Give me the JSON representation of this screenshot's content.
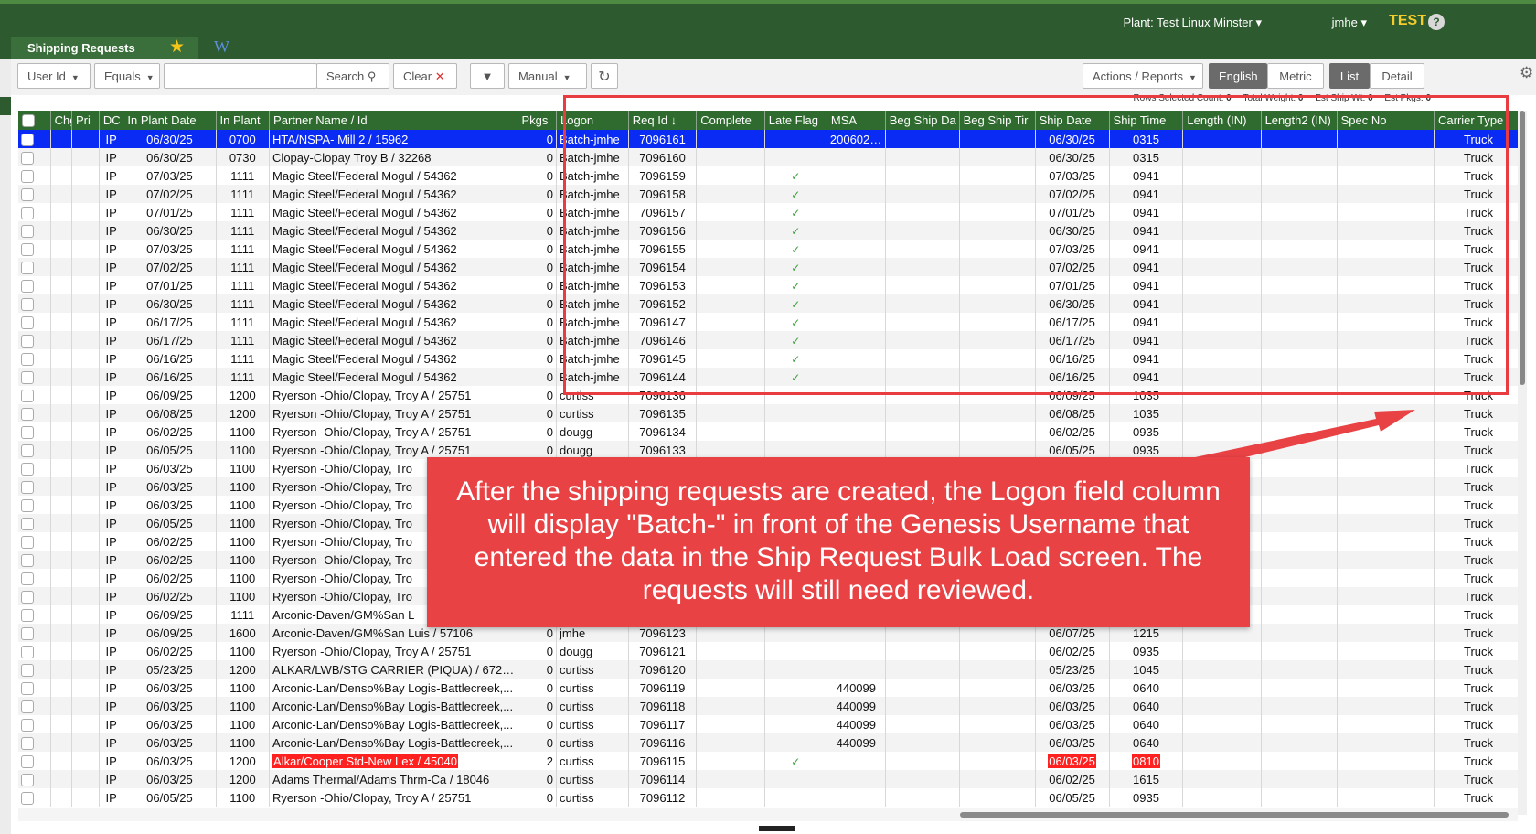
{
  "topbar": {
    "plant": "Plant: Test Linux Minster",
    "user": "jmhe",
    "env": "TEST",
    "help": "?"
  },
  "tab": {
    "label": "Shipping Requests",
    "star": "★",
    "wiki": "W"
  },
  "toolbar": {
    "field": "User Id",
    "operator": "Equals",
    "search_value": "",
    "search_label": "Search",
    "clear_label": "Clear",
    "mode": "Manual",
    "actions": "Actions / Reports",
    "unit_english": "English",
    "unit_metric": "Metric",
    "view_list": "List",
    "view_detail": "Detail"
  },
  "stats": {
    "rows_selected": "Rows Selected Count:",
    "rows_selected_val": "0",
    "total_weight": "Total Weight:",
    "total_weight_val": "0",
    "est_ship": "Est Ship Wt:",
    "est_ship_val": "0",
    "est_pkgs": "Est Pkgs:",
    "est_pkgs_val": "0"
  },
  "columns": [
    "",
    "Chg",
    "Pri",
    "DC",
    "In Plant Date",
    "In Plant",
    "Partner Name / Id",
    "Pkgs",
    "Logon",
    "Req Id ↓",
    "Complete",
    "Late Flag",
    "MSA",
    "Beg Ship Da",
    "Beg Ship Tir",
    "Ship Date",
    "Ship Time",
    "Length (IN)",
    "Length2 (IN)",
    "Spec No",
    "Carrier Type"
  ],
  "rows": [
    {
      "dc": "IP",
      "ipd": "06/30/25",
      "ipt": "0700",
      "partner": "HTA/NSPA- Mill 2 / 15962",
      "pkgs": "0",
      "logon": "Batch-jmhe",
      "req": "7096161",
      "late": "",
      "msa": "2006028...",
      "sdate": "06/30/25",
      "stime": "0315",
      "carrier": "Truck",
      "sel": true
    },
    {
      "dc": "IP",
      "ipd": "06/30/25",
      "ipt": "0730",
      "partner": "Clopay-Clopay Troy B / 32268",
      "pkgs": "0",
      "logon": "Batch-jmhe",
      "req": "7096160",
      "late": "",
      "msa": "",
      "sdate": "06/30/25",
      "stime": "0315",
      "carrier": "Truck"
    },
    {
      "dc": "IP",
      "ipd": "07/03/25",
      "ipt": "1111",
      "partner": "Magic Steel/Federal Mogul / 54362",
      "pkgs": "0",
      "logon": "Batch-jmhe",
      "req": "7096159",
      "late": "✓",
      "msa": "",
      "sdate": "07/03/25",
      "stime": "0941",
      "carrier": "Truck"
    },
    {
      "dc": "IP",
      "ipd": "07/02/25",
      "ipt": "1111",
      "partner": "Magic Steel/Federal Mogul / 54362",
      "pkgs": "0",
      "logon": "Batch-jmhe",
      "req": "7096158",
      "late": "✓",
      "msa": "",
      "sdate": "07/02/25",
      "stime": "0941",
      "carrier": "Truck"
    },
    {
      "dc": "IP",
      "ipd": "07/01/25",
      "ipt": "1111",
      "partner": "Magic Steel/Federal Mogul / 54362",
      "pkgs": "0",
      "logon": "Batch-jmhe",
      "req": "7096157",
      "late": "✓",
      "msa": "",
      "sdate": "07/01/25",
      "stime": "0941",
      "carrier": "Truck"
    },
    {
      "dc": "IP",
      "ipd": "06/30/25",
      "ipt": "1111",
      "partner": "Magic Steel/Federal Mogul / 54362",
      "pkgs": "0",
      "logon": "Batch-jmhe",
      "req": "7096156",
      "late": "✓",
      "msa": "",
      "sdate": "06/30/25",
      "stime": "0941",
      "carrier": "Truck"
    },
    {
      "dc": "IP",
      "ipd": "07/03/25",
      "ipt": "1111",
      "partner": "Magic Steel/Federal Mogul / 54362",
      "pkgs": "0",
      "logon": "Batch-jmhe",
      "req": "7096155",
      "late": "✓",
      "msa": "",
      "sdate": "07/03/25",
      "stime": "0941",
      "carrier": "Truck"
    },
    {
      "dc": "IP",
      "ipd": "07/02/25",
      "ipt": "1111",
      "partner": "Magic Steel/Federal Mogul / 54362",
      "pkgs": "0",
      "logon": "Batch-jmhe",
      "req": "7096154",
      "late": "✓",
      "msa": "",
      "sdate": "07/02/25",
      "stime": "0941",
      "carrier": "Truck"
    },
    {
      "dc": "IP",
      "ipd": "07/01/25",
      "ipt": "1111",
      "partner": "Magic Steel/Federal Mogul / 54362",
      "pkgs": "0",
      "logon": "Batch-jmhe",
      "req": "7096153",
      "late": "✓",
      "msa": "",
      "sdate": "07/01/25",
      "stime": "0941",
      "carrier": "Truck"
    },
    {
      "dc": "IP",
      "ipd": "06/30/25",
      "ipt": "1111",
      "partner": "Magic Steel/Federal Mogul / 54362",
      "pkgs": "0",
      "logon": "Batch-jmhe",
      "req": "7096152",
      "late": "✓",
      "msa": "",
      "sdate": "06/30/25",
      "stime": "0941",
      "carrier": "Truck"
    },
    {
      "dc": "IP",
      "ipd": "06/17/25",
      "ipt": "1111",
      "partner": "Magic Steel/Federal Mogul / 54362",
      "pkgs": "0",
      "logon": "Batch-jmhe",
      "req": "7096147",
      "late": "✓",
      "msa": "",
      "sdate": "06/17/25",
      "stime": "0941",
      "carrier": "Truck"
    },
    {
      "dc": "IP",
      "ipd": "06/17/25",
      "ipt": "1111",
      "partner": "Magic Steel/Federal Mogul / 54362",
      "pkgs": "0",
      "logon": "Batch-jmhe",
      "req": "7096146",
      "late": "✓",
      "msa": "",
      "sdate": "06/17/25",
      "stime": "0941",
      "carrier": "Truck"
    },
    {
      "dc": "IP",
      "ipd": "06/16/25",
      "ipt": "1111",
      "partner": "Magic Steel/Federal Mogul / 54362",
      "pkgs": "0",
      "logon": "Batch-jmhe",
      "req": "7096145",
      "late": "✓",
      "msa": "",
      "sdate": "06/16/25",
      "stime": "0941",
      "carrier": "Truck"
    },
    {
      "dc": "IP",
      "ipd": "06/16/25",
      "ipt": "1111",
      "partner": "Magic Steel/Federal Mogul / 54362",
      "pkgs": "0",
      "logon": "Batch-jmhe",
      "req": "7096144",
      "late": "✓",
      "msa": "",
      "sdate": "06/16/25",
      "stime": "0941",
      "carrier": "Truck"
    },
    {
      "dc": "IP",
      "ipd": "06/09/25",
      "ipt": "1200",
      "partner": "Ryerson -Ohio/Clopay, Troy A / 25751",
      "pkgs": "0",
      "logon": "curtiss",
      "req": "7096136",
      "late": "",
      "msa": "",
      "sdate": "06/09/25",
      "stime": "1035",
      "carrier": "Truck"
    },
    {
      "dc": "IP",
      "ipd": "06/08/25",
      "ipt": "1200",
      "partner": "Ryerson -Ohio/Clopay, Troy A / 25751",
      "pkgs": "0",
      "logon": "curtiss",
      "req": "7096135",
      "late": "",
      "msa": "",
      "sdate": "06/08/25",
      "stime": "1035",
      "carrier": "Truck"
    },
    {
      "dc": "IP",
      "ipd": "06/02/25",
      "ipt": "1100",
      "partner": "Ryerson -Ohio/Clopay, Troy A / 25751",
      "pkgs": "0",
      "logon": "dougg",
      "req": "7096134",
      "late": "",
      "msa": "",
      "sdate": "06/02/25",
      "stime": "0935",
      "carrier": "Truck"
    },
    {
      "dc": "IP",
      "ipd": "06/05/25",
      "ipt": "1100",
      "partner": "Ryerson -Ohio/Clopay, Troy A / 25751",
      "pkgs": "0",
      "logon": "dougg",
      "req": "7096133",
      "late": "",
      "msa": "",
      "sdate": "06/05/25",
      "stime": "0935",
      "carrier": "Truck"
    },
    {
      "dc": "IP",
      "ipd": "06/03/25",
      "ipt": "1100",
      "partner": "Ryerson -Ohio/Clopay, Tro",
      "pkgs": "",
      "logon": "",
      "req": "",
      "late": "",
      "msa": "",
      "sdate": "",
      "stime": "",
      "carrier": "Truck"
    },
    {
      "dc": "IP",
      "ipd": "06/03/25",
      "ipt": "1100",
      "partner": "Ryerson -Ohio/Clopay, Tro",
      "pkgs": "",
      "logon": "",
      "req": "",
      "late": "",
      "msa": "",
      "sdate": "",
      "stime": "",
      "carrier": "Truck"
    },
    {
      "dc": "IP",
      "ipd": "06/03/25",
      "ipt": "1100",
      "partner": "Ryerson -Ohio/Clopay, Tro",
      "pkgs": "",
      "logon": "",
      "req": "",
      "late": "",
      "msa": "",
      "sdate": "",
      "stime": "",
      "carrier": "Truck"
    },
    {
      "dc": "IP",
      "ipd": "06/05/25",
      "ipt": "1100",
      "partner": "Ryerson -Ohio/Clopay, Tro",
      "pkgs": "",
      "logon": "",
      "req": "",
      "late": "",
      "msa": "",
      "sdate": "",
      "stime": "",
      "carrier": "Truck"
    },
    {
      "dc": "IP",
      "ipd": "06/02/25",
      "ipt": "1100",
      "partner": "Ryerson -Ohio/Clopay, Tro",
      "pkgs": "",
      "logon": "",
      "req": "",
      "late": "",
      "msa": "",
      "sdate": "",
      "stime": "",
      "carrier": "Truck"
    },
    {
      "dc": "IP",
      "ipd": "06/02/25",
      "ipt": "1100",
      "partner": "Ryerson -Ohio/Clopay, Tro",
      "pkgs": "",
      "logon": "",
      "req": "",
      "late": "",
      "msa": "",
      "sdate": "",
      "stime": "",
      "carrier": "Truck"
    },
    {
      "dc": "IP",
      "ipd": "06/02/25",
      "ipt": "1100",
      "partner": "Ryerson -Ohio/Clopay, Tro",
      "pkgs": "",
      "logon": "",
      "req": "",
      "late": "",
      "msa": "",
      "sdate": "",
      "stime": "",
      "carrier": "Truck"
    },
    {
      "dc": "IP",
      "ipd": "06/02/25",
      "ipt": "1100",
      "partner": "Ryerson -Ohio/Clopay, Tro",
      "pkgs": "",
      "logon": "",
      "req": "",
      "late": "",
      "msa": "",
      "sdate": "",
      "stime": "",
      "carrier": "Truck"
    },
    {
      "dc": "IP",
      "ipd": "06/09/25",
      "ipt": "1111",
      "partner": "Arconic-Daven/GM%San L",
      "pkgs": "",
      "logon": "",
      "req": "",
      "late": "",
      "msa": "",
      "sdate": "",
      "stime": "",
      "carrier": "Truck"
    },
    {
      "dc": "IP",
      "ipd": "06/09/25",
      "ipt": "1600",
      "partner": "Arconic-Daven/GM%San Luis / 57106",
      "pkgs": "0",
      "logon": "jmhe",
      "req": "7096123",
      "late": "",
      "msa": "",
      "sdate": "06/07/25",
      "stime": "1215",
      "carrier": "Truck"
    },
    {
      "dc": "IP",
      "ipd": "06/02/25",
      "ipt": "1100",
      "partner": "Ryerson -Ohio/Clopay, Troy A / 25751",
      "pkgs": "0",
      "logon": "dougg",
      "req": "7096121",
      "late": "",
      "msa": "",
      "sdate": "06/02/25",
      "stime": "0935",
      "carrier": "Truck"
    },
    {
      "dc": "IP",
      "ipd": "05/23/25",
      "ipt": "1200",
      "partner": "ALKAR/LWB/STG CARRIER (PIQUA) / 67293",
      "pkgs": "0",
      "logon": "curtiss",
      "req": "7096120",
      "late": "",
      "msa": "",
      "sdate": "05/23/25",
      "stime": "1045",
      "carrier": "Truck"
    },
    {
      "dc": "IP",
      "ipd": "06/03/25",
      "ipt": "1100",
      "partner": "Arconic-Lan/Denso%Bay Logis-Battlecreek,...",
      "pkgs": "0",
      "logon": "curtiss",
      "req": "7096119",
      "late": "",
      "msa": "440099",
      "sdate": "06/03/25",
      "stime": "0640",
      "carrier": "Truck"
    },
    {
      "dc": "IP",
      "ipd": "06/03/25",
      "ipt": "1100",
      "partner": "Arconic-Lan/Denso%Bay Logis-Battlecreek,...",
      "pkgs": "0",
      "logon": "curtiss",
      "req": "7096118",
      "late": "",
      "msa": "440099",
      "sdate": "06/03/25",
      "stime": "0640",
      "carrier": "Truck"
    },
    {
      "dc": "IP",
      "ipd": "06/03/25",
      "ipt": "1100",
      "partner": "Arconic-Lan/Denso%Bay Logis-Battlecreek,...",
      "pkgs": "0",
      "logon": "curtiss",
      "req": "7096117",
      "late": "",
      "msa": "440099",
      "sdate": "06/03/25",
      "stime": "0640",
      "carrier": "Truck"
    },
    {
      "dc": "IP",
      "ipd": "06/03/25",
      "ipt": "1100",
      "partner": "Arconic-Lan/Denso%Bay Logis-Battlecreek,...",
      "pkgs": "0",
      "logon": "curtiss",
      "req": "7096116",
      "late": "",
      "msa": "440099",
      "sdate": "06/03/25",
      "stime": "0640",
      "carrier": "Truck"
    },
    {
      "dc": "IP",
      "ipd": "06/03/25",
      "ipt": "1200",
      "partner": "Alkar/Cooper Std-New Lex / 45040",
      "pkgs": "2",
      "logon": "curtiss",
      "req": "7096115",
      "late": "✓",
      "msa": "",
      "sdate": "06/03/25",
      "stime": "0810",
      "carrier": "Truck",
      "redflag": true
    },
    {
      "dc": "IP",
      "ipd": "06/03/25",
      "ipt": "1200",
      "partner": "Adams Thermal/Adams Thrm-Ca / 18046",
      "pkgs": "0",
      "logon": "curtiss",
      "req": "7096114",
      "late": "",
      "msa": "",
      "sdate": "06/02/25",
      "stime": "1615",
      "carrier": "Truck"
    },
    {
      "dc": "IP",
      "ipd": "06/05/25",
      "ipt": "1100",
      "partner": "Ryerson -Ohio/Clopay, Troy A / 25751",
      "pkgs": "0",
      "logon": "curtiss",
      "req": "7096112",
      "late": "",
      "msa": "",
      "sdate": "06/05/25",
      "stime": "0935",
      "carrier": "Truck"
    }
  ],
  "callout": {
    "text": "After the shipping requests are created, the Logon field column will display \"Batch-\" in front of the Genesis Username that entered the data in the Ship Request Bulk Load screen. The requests will still need reviewed."
  },
  "colors": {
    "header_green": "#2d5a2f",
    "selection_blue": "#0a2bf4",
    "callout_red": "#e84245"
  }
}
